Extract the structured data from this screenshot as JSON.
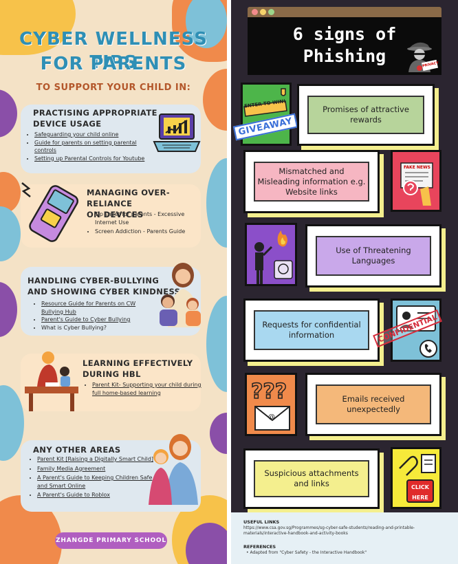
{
  "left": {
    "title_line1": "CYBER WELLNESS TIPS",
    "title_line2": "FOR PARENTS",
    "subtitle": "TO SUPPORT YOUR CHILD IN:",
    "sections": [
      {
        "heading_line1": "PRACTISING APPROPRIATE",
        "heading_line2": "DEVICE USAGE",
        "items": [
          "Safeguarding your child online",
          "Guide for parents on setting parental controls",
          "Setting up Parental Controls for Youtube"
        ]
      },
      {
        "heading_line1": "MANAGING OVER-RELIANCE",
        "heading_line2": "ON DEVICES",
        "items": [
          "Tip sheet for parents - Excessive Internet Use",
          "Screen Addiction - Parents Guide"
        ]
      },
      {
        "heading_line1": "HANDLING CYBER-BULLYING",
        "heading_line2": "AND SHOWING CYBER KINDNESS",
        "items": [
          "Resource Guide for Parents on CW Bullying Hub",
          "Parent's Guide to Cyber Bullying",
          "What is Cyber Bullying?"
        ]
      },
      {
        "heading_line1": "LEARNING EFFECTIVELY",
        "heading_line2": "DURING HBL",
        "items": [
          "Parent Kit- Supporting your child during full home-based learning"
        ]
      },
      {
        "heading_line1": "ANY OTHER AREAS",
        "heading_line2": "",
        "items": [
          "Parent Kit [Raising a Digitally Smart Child]",
          "Family Media Agreement",
          "A Parent's Guide to Keeping Children Safe and Smart Online",
          "A Parent's Guide to Roblox"
        ]
      }
    ],
    "school": "ZHANGDE PRIMARY SCHOOL"
  },
  "right": {
    "title_line1": "6 signs of",
    "title_line2": "Phishing",
    "privacy_stamp": "PRIVACY",
    "signs": [
      {
        "text": "Promises of attractive rewards",
        "color": "#b7d49b"
      },
      {
        "text": "Mismatched and Misleading information e.g. Website links",
        "color": "#f6b6c2"
      },
      {
        "text": "Use of Threatening Languages",
        "color": "#c9a8ea"
      },
      {
        "text": "Requests for confidential information",
        "color": "#a9d8f0"
      },
      {
        "text": "Emails received unexpectedly",
        "color": "#f4b87a"
      },
      {
        "text": "Suspicious attachments and links",
        "color": "#f4ef8e"
      }
    ],
    "badges": {
      "enter": "ENTER TO WIN!",
      "giveaway": "GIVEAWAY",
      "fake_news": "FAKE NEWS",
      "confidential": "CONFIDENTIAL",
      "click": "CLICK HERE"
    },
    "useful_links_heading": "USEFUL LINKS",
    "useful_links_url": "https://www.csa.gov.sg/Programmes/sg-cyber-safe-students/reading-and-printable-materials/interactive-handbook-and-activity-books",
    "references_heading": "REFERENCES",
    "references_item": "Adapted from \"Cyber Safety - the Interactive Handbook\""
  },
  "colors": {
    "left_bg": "#f4e2c6",
    "title_blue": "#2f8fb5",
    "right_bg": "#2b2530",
    "school_pill": "#b05ec0"
  }
}
